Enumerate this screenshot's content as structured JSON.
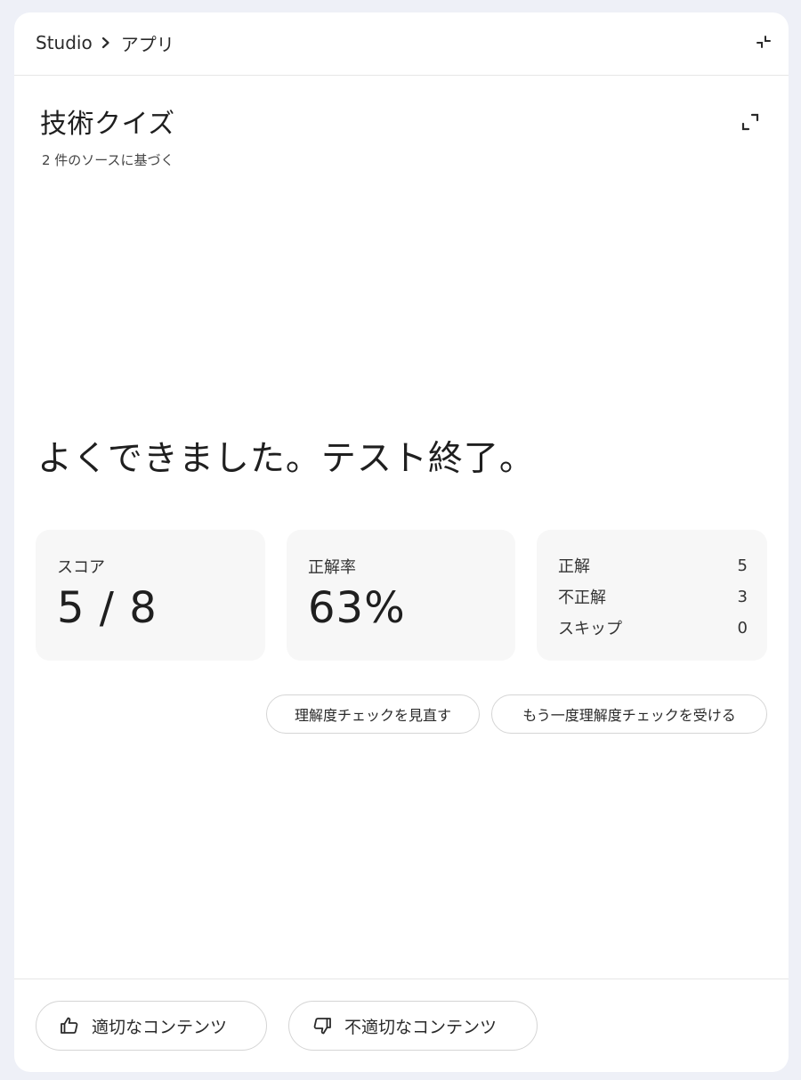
{
  "breadcrumb": {
    "root": "Studio",
    "current": "アプリ",
    "separator_icon": "chevron-right-icon"
  },
  "header": {
    "collapse_icon": "collapse-icon"
  },
  "quiz": {
    "title": "技術クイズ",
    "subtitle": "2 件のソースに基づく",
    "expand_icon": "fullscreen-icon"
  },
  "result": {
    "heading": "よくできました。テスト終了。"
  },
  "stats": {
    "score": {
      "label": "スコア",
      "value": "5 / 8"
    },
    "accuracy": {
      "label": "正解率",
      "value": "63%"
    },
    "breakdown": [
      {
        "label": "正解",
        "value": "5"
      },
      {
        "label": "不正解",
        "value": "3"
      },
      {
        "label": "スキップ",
        "value": "0"
      }
    ]
  },
  "actions": {
    "review": "理解度チェックを見直す",
    "retake": "もう一度理解度チェックを受ける"
  },
  "feedback": {
    "good": {
      "label": "適切なコンテンツ",
      "icon": "thumbs-up-icon"
    },
    "bad": {
      "label": "不適切なコンテンツ",
      "icon": "thumbs-down-icon"
    }
  }
}
